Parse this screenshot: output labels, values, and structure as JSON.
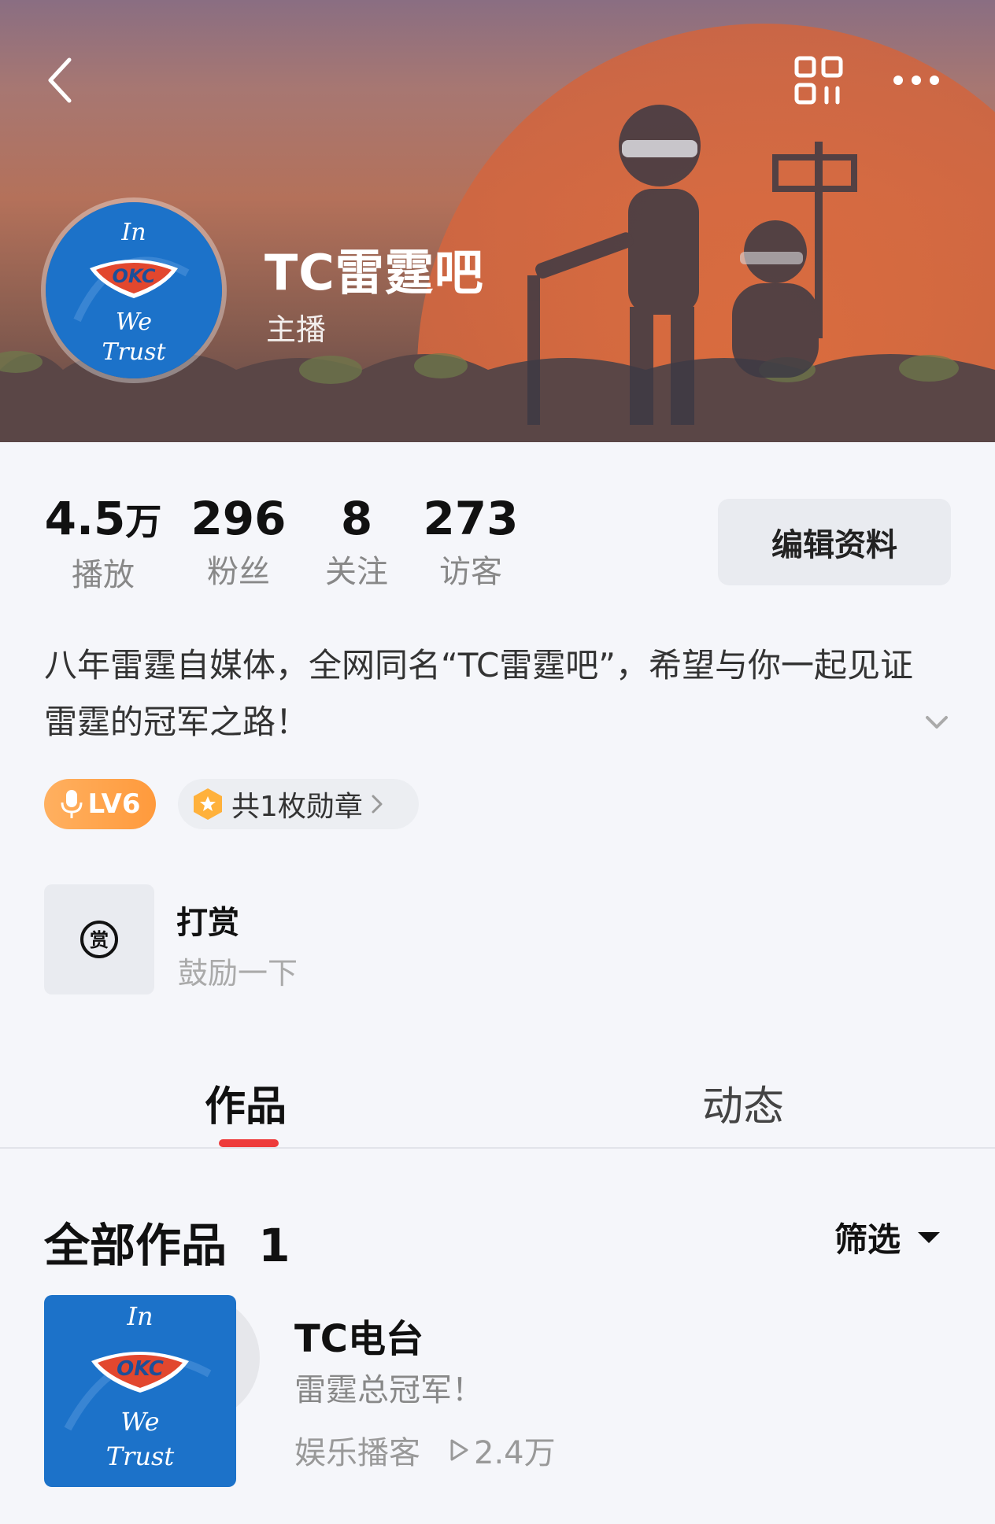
{
  "header": {
    "title": "TC雷霆吧",
    "role": "主播",
    "avatar_text": [
      "In",
      "OKC",
      "We",
      "Trust"
    ]
  },
  "icons": {
    "back": "chevron-left-icon",
    "qr": "qr-code-icon",
    "more": "more-dots-icon",
    "bio_expand": "chevron-down-icon",
    "mic": "mic-icon",
    "medal": "medal-icon",
    "medal_arrow": "chevron-right-icon",
    "reward": "reward-coin-icon",
    "filter": "triangle-down-icon",
    "play": "play-icon"
  },
  "stats": [
    {
      "value": "4.5",
      "unit": "万",
      "label": "播放"
    },
    {
      "value": "296",
      "unit": "",
      "label": "粉丝"
    },
    {
      "value": "8",
      "unit": "",
      "label": "关注"
    },
    {
      "value": "273",
      "unit": "",
      "label": "访客"
    }
  ],
  "edit_profile_label": "编辑资料",
  "bio": "八年雷霆自媒体，全网同名“TC雷霆吧”，希望与你一起见证雷霆的冠军之路！",
  "badges": {
    "level": "LV6",
    "medals": "共1枚勋章"
  },
  "reward": {
    "icon_char": "赏",
    "title": "打赏",
    "subtitle": "鼓励一下"
  },
  "tabs": [
    {
      "label": "作品",
      "active": true
    },
    {
      "label": "动态",
      "active": false
    }
  ],
  "section": {
    "title": "全部作品",
    "count": "1",
    "filter_label": "筛选"
  },
  "works": [
    {
      "title": "TC电台",
      "description": "雷霆总冠军！",
      "category": "娱乐播客",
      "plays": "2.4万"
    }
  ],
  "colors": {
    "accent_red": "#ee3b3b",
    "level_orange": "#ff9a3c",
    "okc_blue": "#1c72c9",
    "page_bg": "#f5f6fa"
  }
}
